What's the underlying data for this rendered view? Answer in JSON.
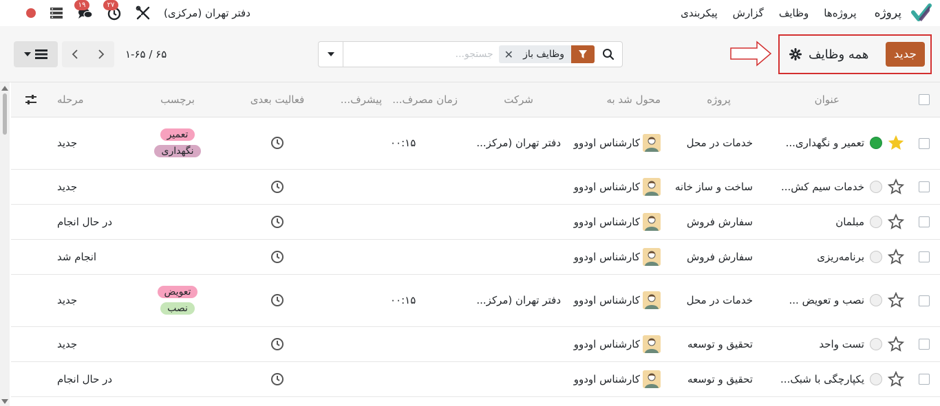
{
  "navbar": {
    "app_name": "پروژه",
    "menu": [
      "پروژه‌ها",
      "وظایف",
      "گزارش",
      "پیکربندی"
    ],
    "company": "دفتر تهران (مرکزی)",
    "messages_count": "۱۹",
    "activities_count": "۲۷",
    "accent": "#d9534f"
  },
  "control_panel": {
    "new_button": "جدید",
    "breadcrumb": "همه وظایف",
    "search": {
      "facet_label": "وظایف باز",
      "placeholder": "جستجو..."
    },
    "pager": "۱-۶۵ / ۶۵",
    "primary_color": "#b85c2c"
  },
  "table": {
    "columns": [
      "عنوان",
      "پروژه",
      "محول شد به",
      "شرکت",
      "زمان مصرف...",
      "پیشرف...",
      "فعالیت بعدی",
      "برچسب",
      "مرحله"
    ],
    "rows": [
      {
        "title": "تعمیر و نگهداری...",
        "starred": true,
        "kanban": "green",
        "project": "خدمات در محل",
        "assignee": "کارشناس اودوو",
        "company": "دفتر تهران (مرکز...",
        "time": "۰۰:۱۵",
        "tags": [
          {
            "name": "تعمیر",
            "color": "#f7a1be"
          },
          {
            "name": "نگهداری",
            "color": "#d7a8c3"
          }
        ],
        "stage": "جدید"
      },
      {
        "title": "خدمات سیم کش...",
        "starred": false,
        "kanban": "normal",
        "project": "ساخت و ساز خانه",
        "assignee": "کارشناس اودوو",
        "company": "",
        "time": "",
        "tags": [],
        "stage": "جدید"
      },
      {
        "title": "مبلمان",
        "starred": false,
        "kanban": "normal",
        "project": "سفارش فروش",
        "assignee": "کارشناس اودوو",
        "company": "",
        "time": "",
        "tags": [],
        "stage": "در حال انجام"
      },
      {
        "title": "برنامه‌ریزی",
        "starred": false,
        "kanban": "normal",
        "project": "سفارش فروش",
        "assignee": "کارشناس اودوو",
        "company": "",
        "time": "",
        "tags": [],
        "stage": "انجام شد"
      },
      {
        "title": "نصب و تعویض ...",
        "starred": false,
        "kanban": "normal",
        "project": "خدمات در محل",
        "assignee": "کارشناس اودوو",
        "company": "دفتر تهران (مرکز...",
        "time": "۰۰:۱۵",
        "tags": [
          {
            "name": "تعویض",
            "color": "#f7a1be"
          },
          {
            "name": "نصب",
            "color": "#c6e6b8"
          }
        ],
        "stage": "جدید"
      },
      {
        "title": "تست واحد",
        "starred": false,
        "kanban": "normal",
        "project": "تحقیق و توسعه",
        "assignee": "کارشناس اودوو",
        "company": "",
        "time": "",
        "tags": [],
        "stage": "جدید"
      },
      {
        "title": "یکپارچگی با شبک...",
        "starred": false,
        "kanban": "normal",
        "project": "تحقیق و توسعه",
        "assignee": "کارشناس اودوو",
        "company": "",
        "time": "",
        "tags": [],
        "stage": "در حال انجام"
      }
    ]
  }
}
